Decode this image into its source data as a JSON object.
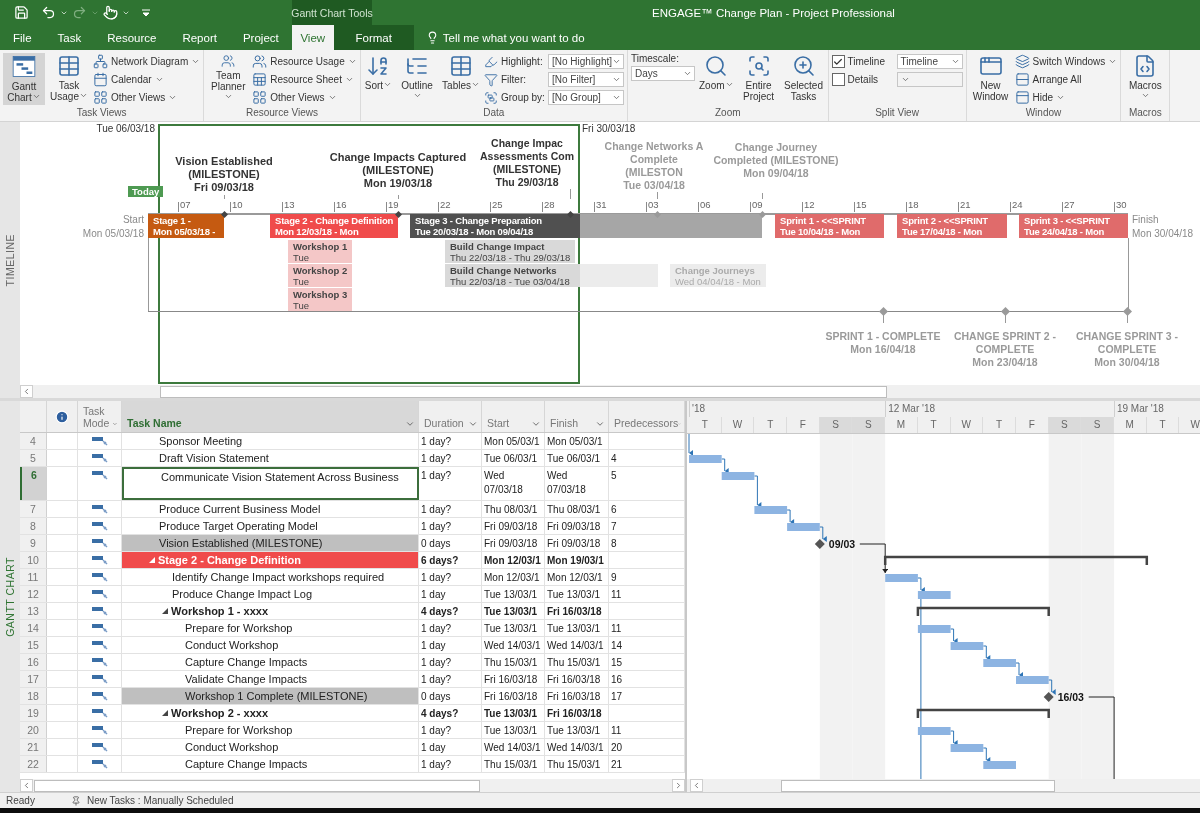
{
  "title_bar": {
    "contextual_label": "Gantt Chart Tools",
    "title": "ENGAGE™ Change Plan  -  Project Professional"
  },
  "tabs": [
    {
      "label": "File",
      "selected": false,
      "contextual": false
    },
    {
      "label": "Task",
      "selected": false,
      "contextual": false
    },
    {
      "label": "Resource",
      "selected": false,
      "contextual": false
    },
    {
      "label": "Report",
      "selected": false,
      "contextual": false
    },
    {
      "label": "Project",
      "selected": false,
      "contextual": false
    },
    {
      "label": "View",
      "selected": true,
      "contextual": false
    },
    {
      "label": "Format",
      "selected": false,
      "contextual": true
    }
  ],
  "tell_me": "Tell me what you want to do",
  "ribbon": [
    {
      "label": "Task Views",
      "items": [
        {
          "kind": "large",
          "label": "Gantt Chart",
          "dropdown": true,
          "selected": true
        },
        {
          "kind": "large",
          "label": "Task Usage",
          "dropdown": true,
          "selected": false
        },
        {
          "kind": "stack",
          "items": [
            {
              "kind": "small",
              "label": "Network Diagram",
              "dropdown": true
            },
            {
              "kind": "small",
              "label": "Calendar",
              "dropdown": true
            },
            {
              "kind": "small",
              "label": "Other Views",
              "dropdown": true
            }
          ]
        }
      ]
    },
    {
      "label": "Resource Views",
      "items": [
        {
          "kind": "large",
          "label": "Team Planner",
          "dropdown": true,
          "selected": false
        },
        {
          "kind": "stack",
          "items": [
            {
              "kind": "small",
              "label": "Resource Usage",
              "dropdown": true
            },
            {
              "kind": "small",
              "label": "Resource Sheet",
              "dropdown": true
            },
            {
              "kind": "small",
              "label": "Other Views",
              "dropdown": true
            }
          ]
        }
      ]
    },
    {
      "label": "Data",
      "items": [
        {
          "kind": "large",
          "label": "Sort",
          "dropdown": true,
          "selected": false
        },
        {
          "kind": "large",
          "label": "Outline",
          "dropdown": true,
          "selected": false
        },
        {
          "kind": "large",
          "label": "Tables",
          "dropdown": true,
          "selected": false
        },
        {
          "kind": "stack",
          "items": [
            {
              "kind": "combo",
              "label": "Highlight:",
              "value": "[No Highlight]"
            },
            {
              "kind": "combo",
              "label": "Filter:",
              "value": "[No Filter]"
            },
            {
              "kind": "combo",
              "label": "Group by:",
              "value": "[No Group]"
            }
          ]
        }
      ]
    },
    {
      "label": "Zoom",
      "items": [
        {
          "kind": "field",
          "label": "Timescale:",
          "value": "Days"
        },
        {
          "kind": "large",
          "label": "Zoom",
          "dropdown": true,
          "selected": false
        },
        {
          "kind": "large",
          "label": "Entire Project",
          "dropdown": false,
          "selected": false
        },
        {
          "kind": "large",
          "label": "Selected Tasks",
          "dropdown": false,
          "selected": false
        }
      ]
    },
    {
      "label": "Split View",
      "items": [
        {
          "kind": "stack",
          "items": [
            {
              "kind": "check",
              "label": "Timeline",
              "checked": true,
              "value": "Timeline"
            },
            {
              "kind": "check",
              "label": "Details",
              "checked": false
            }
          ]
        }
      ]
    },
    {
      "label": "Window",
      "items": [
        {
          "kind": "large",
          "label": "New Window",
          "dropdown": false,
          "selected": false
        },
        {
          "kind": "stack",
          "items": [
            {
              "kind": "small",
              "label": "Switch Windows",
              "dropdown": true
            },
            {
              "kind": "small",
              "label": "Arrange All",
              "dropdown": false
            },
            {
              "kind": "small",
              "label": "Hide",
              "dropdown": true
            }
          ]
        }
      ]
    },
    {
      "label": "Macros",
      "items": [
        {
          "kind": "large",
          "label": "Macros",
          "dropdown": true,
          "selected": false
        }
      ]
    }
  ],
  "timeline": {
    "label": "TIMELINE",
    "top_dates": [
      "Tue 06/03/18",
      "Fri 30/03/18"
    ],
    "today": "Today",
    "start": {
      "label": "Start",
      "date": "Mon 05/03/18"
    },
    "finish": {
      "label": "Finish",
      "date": "Mon 30/04/18"
    },
    "ticks": [
      "07",
      "10",
      "13",
      "16",
      "19",
      "22",
      "25",
      "28",
      "31",
      "03",
      "06",
      "09",
      "12",
      "15",
      "18",
      "21",
      "24",
      "27",
      "30"
    ],
    "bars": [
      {
        "title": "Stage 1 -",
        "dates": "Mon 05/03/18 -",
        "color": "#c55a11"
      },
      {
        "title": "Stage 2 - Change Definition",
        "dates": "Mon 12/03/18 - Mon",
        "color": "#f04b4b"
      },
      {
        "title": "Stage 3 - Change Preparation",
        "dates": "Tue 20/03/18 - Mon 09/04/18",
        "color": "#505050"
      },
      {
        "title": "Sprint 1 - <<SPRINT",
        "dates": "Tue 10/04/18 - Mon",
        "color": "#e06b6b"
      },
      {
        "title": "Sprint 2 - <<SPRINT",
        "dates": "Tue 17/04/18 - Mon",
        "color": "#e06b6b"
      },
      {
        "title": "Sprint 3 - <<SPRINT",
        "dates": "Tue 24/04/18 - Mon",
        "color": "#e06b6b"
      }
    ],
    "milestones": [
      {
        "name": "Vision Established (MILESTONE)",
        "date": "Fri 09/03/18",
        "faded": false
      },
      {
        "name": "Change Impacts Captured (MILESTONE)",
        "date": "Mon 19/03/18",
        "faded": false
      },
      {
        "name": "Change Impac Assessments Com (MILESTONE)",
        "date": "Thu 29/03/18",
        "faded": false
      },
      {
        "name": "Change Networks A Complete (MILESTON",
        "date": "Tue 03/04/18",
        "faded": true
      },
      {
        "name": "Change Journey Completed (MILESTONE)",
        "date": "Mon 09/04/18",
        "faded": true
      }
    ],
    "tasks": [
      {
        "title": "Workshop 1",
        "dates": "Tue",
        "color": "#f4c7c7",
        "faded": false
      },
      {
        "title": "Workshop 2",
        "dates": "Tue",
        "color": "#f4c7c7",
        "faded": false
      },
      {
        "title": "Workshop 3",
        "dates": "Tue",
        "color": "#f4c7c7",
        "faded": false
      },
      {
        "title": "Build Change Impact",
        "dates": "Thu 22/03/18 - Thu 29/03/18",
        "color": "#d9d9d9",
        "faded": false
      },
      {
        "title": "Build Change Networks",
        "dates": "Thu 22/03/18 - Tue 03/04/18",
        "color": "#d9d9d9",
        "faded": false
      },
      {
        "title": "Change Journeys",
        "dates": "Wed 04/04/18 - Mon",
        "color": "#ececec",
        "faded": true
      }
    ],
    "bottom_milestones": [
      {
        "name": "SPRINT 1 - COMPLETE",
        "date": "Mon 16/04/18"
      },
      {
        "name": "CHANGE SPRINT 2 - COMPLETE",
        "date": "Mon 23/04/18"
      },
      {
        "name": "CHANGE SPRINT 3 - COMPLETE",
        "date": "Mon 30/04/18"
      }
    ]
  },
  "gantt": {
    "label": "GANTT CHART",
    "columns": [
      {
        "label": "Task Mode",
        "selected": false
      },
      {
        "label": "Task Name",
        "selected": true
      },
      {
        "label": "Duration",
        "selected": false
      },
      {
        "label": "Start",
        "selected": false
      },
      {
        "label": "Finish",
        "selected": false
      },
      {
        "label": "Predecessors",
        "selected": false
      }
    ],
    "rows": [
      {
        "id": "4",
        "name": "Sponsor Meeting",
        "duration": "1 day?",
        "start": "Mon 05/03/1",
        "finish": "Mon 05/03/1",
        "selected": false
      },
      {
        "id": "5",
        "name": "Draft Vision Statement",
        "duration": "1 day?",
        "start": "Tue 06/03/1",
        "finish": "Tue 06/03/1",
        "predecessors": "4",
        "selected": false
      },
      {
        "id": "6",
        "name": "Communicate Vision Statement Across Business",
        "duration": "1 day?",
        "start": "Wed 07/03/18",
        "finish": "Wed 07/03/18",
        "predecessors": "5",
        "selected": true
      },
      {
        "id": "7",
        "name": "Produce Current Business Model",
        "duration": "1 day?",
        "start": "Thu 08/03/1",
        "finish": "Thu 08/03/1",
        "predecessors": "6",
        "selected": false
      },
      {
        "id": "8",
        "name": "Produce Target Operating Model",
        "duration": "1 day?",
        "start": "Fri 09/03/18",
        "finish": "Fri 09/03/18",
        "predecessors": "7",
        "selected": false
      },
      {
        "id": "9",
        "name": "Vision Established (MILESTONE)",
        "duration": "0 days",
        "start": "Fri 09/03/18",
        "finish": "Fri 09/03/18",
        "predecessors": "8",
        "selected": false,
        "color": "#bfbfbf"
      },
      {
        "id": "10",
        "name": "Stage 2 - Change Definition",
        "duration": "6 days?",
        "start": "Mon 12/03/1",
        "finish": "Mon 19/03/1",
        "selected": false,
        "color": "#f04b4b",
        "children": [
          {
            "id": "11",
            "name": "Identify Change Impact workshops required",
            "duration": "1 day?",
            "start": "Mon 12/03/1",
            "finish": "Mon 12/03/1",
            "predecessors": "9",
            "selected": false
          },
          {
            "id": "12",
            "name": "Produce Change Impact Log",
            "duration": "1 day",
            "start": "Tue 13/03/1",
            "finish": "Tue 13/03/1",
            "predecessors": "11",
            "selected": false
          },
          {
            "id": "13",
            "name": "Workshop 1 - xxxx",
            "duration": "4 days?",
            "start": "Tue 13/03/1",
            "finish": "Fri 16/03/18",
            "selected": false,
            "children": [
              {
                "id": "14",
                "name": "Prepare for Workshop",
                "duration": "1 day?",
                "start": "Tue 13/03/1",
                "finish": "Tue 13/03/1",
                "predecessors": "11",
                "selected": false
              },
              {
                "id": "15",
                "name": "Conduct Workshop",
                "duration": "1 day",
                "start": "Wed 14/03/1",
                "finish": "Wed 14/03/1",
                "predecessors": "14",
                "selected": false
              },
              {
                "id": "16",
                "name": "Capture Change Impacts",
                "duration": "1 day?",
                "start": "Thu 15/03/1",
                "finish": "Thu 15/03/1",
                "predecessors": "15",
                "selected": false
              },
              {
                "id": "17",
                "name": "Validate Change Impacts",
                "duration": "1 day?",
                "start": "Fri 16/03/18",
                "finish": "Fri 16/03/18",
                "predecessors": "16",
                "selected": false
              },
              {
                "id": "18",
                "name": "Workshop 1 Complete (MILESTONE)",
                "duration": "0 days",
                "start": "Fri 16/03/18",
                "finish": "Fri 16/03/18",
                "predecessors": "17",
                "selected": false,
                "color": "#bfbfbf"
              }
            ]
          },
          {
            "id": "19",
            "name": "Workshop 2 - xxxx",
            "duration": "4 days?",
            "start": "Tue 13/03/1",
            "finish": "Fri 16/03/18",
            "selected": false,
            "children": [
              {
                "id": "20",
                "name": "Prepare for Workshop",
                "duration": "1 day?",
                "start": "Tue 13/03/1",
                "finish": "Tue 13/03/1",
                "predecessors": "11",
                "selected": false
              },
              {
                "id": "21",
                "name": "Conduct Workshop",
                "duration": "1 day",
                "start": "Wed 14/03/1",
                "finish": "Wed 14/03/1",
                "predecessors": "20",
                "selected": false
              },
              {
                "id": "22",
                "name": "Capture Change Impacts",
                "duration": "1 day?",
                "start": "Thu 15/03/1",
                "finish": "Thu 15/03/1",
                "predecessors": "21",
                "selected": false
              }
            ]
          }
        ]
      }
    ],
    "periods": [
      "'18",
      "12 Mar '18",
      "19 Mar '18"
    ],
    "days": [
      {
        "label": "T",
        "weekend": false
      },
      {
        "label": "W",
        "weekend": false
      },
      {
        "label": "T",
        "weekend": false
      },
      {
        "label": "F",
        "weekend": false
      },
      {
        "label": "S",
        "weekend": true
      },
      {
        "label": "S",
        "weekend": true
      },
      {
        "label": "M",
        "weekend": false
      },
      {
        "label": "T",
        "weekend": false
      },
      {
        "label": "W",
        "weekend": false
      },
      {
        "label": "T",
        "weekend": false
      },
      {
        "label": "F",
        "weekend": false
      },
      {
        "label": "S",
        "weekend": true
      },
      {
        "label": "S",
        "weekend": true
      },
      {
        "label": "M",
        "weekend": false
      },
      {
        "label": "T",
        "weekend": false
      },
      {
        "label": "W",
        "weekend": false
      }
    ],
    "milestone_labels": [
      "09/03",
      "16/03"
    ]
  },
  "status_bar": {
    "ready": "Ready",
    "mode": "New Tasks : Manually Scheduled"
  }
}
